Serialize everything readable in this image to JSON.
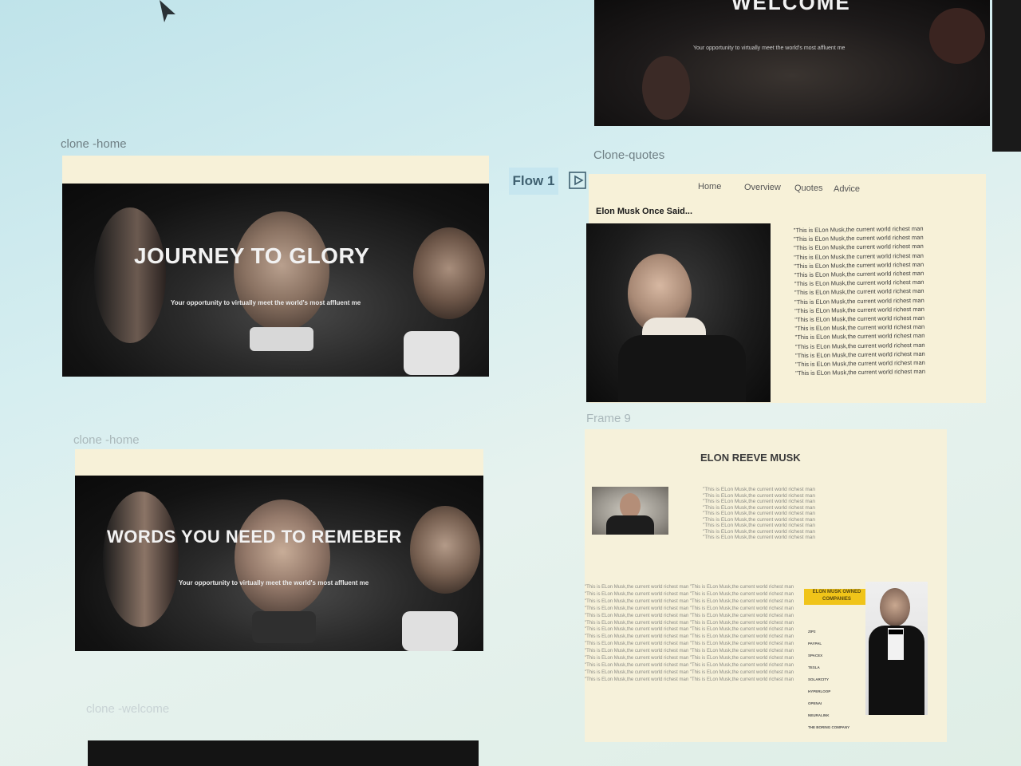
{
  "canvas": {
    "background": "#d6eef0",
    "accent": "#3f6070",
    "frame_background": "#f7f1d8",
    "badge_color": "#f0c419"
  },
  "welcome_frame": {
    "title": "WELCOME",
    "subtitle": "Your opportunity to virtually meet the world's most affluent me"
  },
  "frames": [
    {
      "label": "clone -home",
      "hero_title": "JOURNEY TO GLORY",
      "hero_subtitle": "Your opportunity to virtually meet the world's most affluent me"
    },
    {
      "label": "clone -home",
      "hero_title": "WORDS YOU NEED TO REMEBER",
      "hero_subtitle": "Your opportunity to virtually meet the world's most affluent me"
    },
    {
      "label": "clone -welcome"
    }
  ],
  "flow": {
    "label": "Flow 1",
    "icon": "play-frame-icon"
  },
  "quotes_frame": {
    "label": "Clone-quotes",
    "nav": [
      "Home",
      "Overview",
      "Quotes",
      "Advice"
    ],
    "heading": "Elon Musk Once Said...",
    "quote_line": "\"This is ELon Musk,the current world richest man",
    "quote_count": 17
  },
  "frame9": {
    "label": "Frame 9",
    "title": "ELON REEVE MUSK",
    "quote_line": "\"This is ELon Musk,the current world richest man",
    "quote_count": 9,
    "body_line": "\"This is ELon Musk,the current world richest man \"This is ELon Musk,the current world richest man",
    "body_count": 14,
    "badge_label": "ELON MUSK OWNED COMPANIES",
    "companies": [
      "ZIP2",
      "PAYPAL",
      "SPACEX",
      "TESLA",
      "SOLARCITY",
      "HYPERLOOP",
      "OPENAI",
      "NEURALINK",
      "THE BORING COMPANY"
    ]
  }
}
